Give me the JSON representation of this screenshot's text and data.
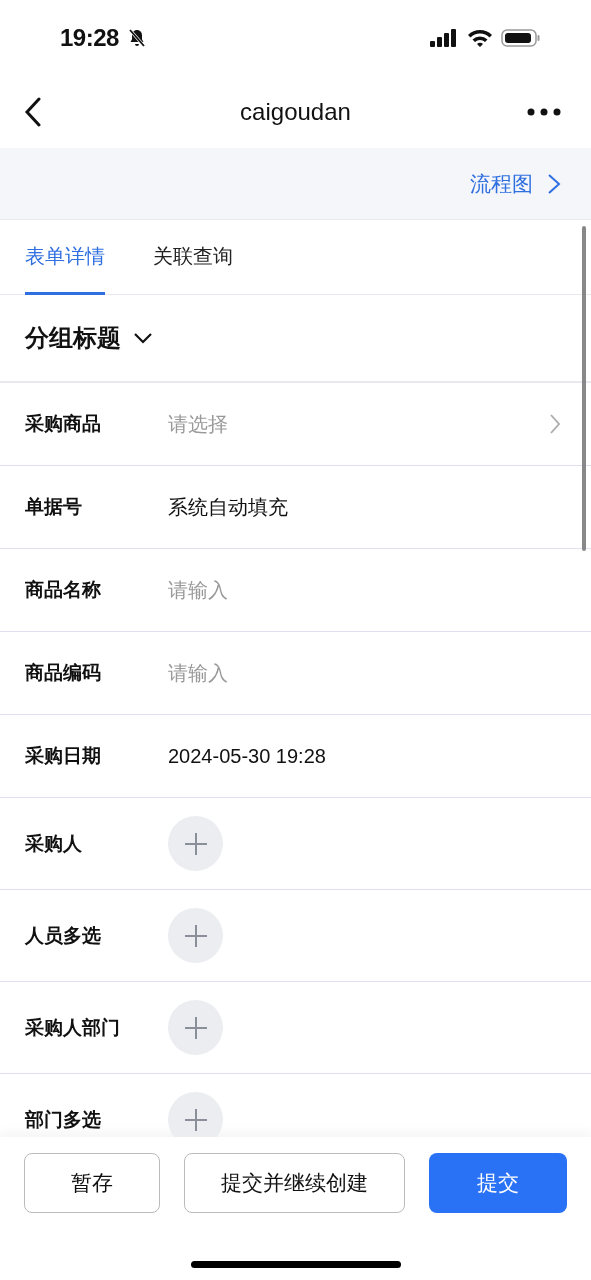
{
  "status_bar": {
    "time": "19:28"
  },
  "nav": {
    "title": "caigoudan"
  },
  "flow_link": {
    "label": "流程图"
  },
  "tabs": [
    {
      "label": "表单详情",
      "selected": true
    },
    {
      "label": "关联查询",
      "selected": false
    }
  ],
  "group": {
    "title": "分组标题",
    "expanded": true
  },
  "fields": [
    {
      "kind": "select",
      "label": "采购商品",
      "placeholder": "请选择"
    },
    {
      "kind": "text",
      "label": "单据号",
      "value": "系统自动填充"
    },
    {
      "kind": "input",
      "label": "商品名称",
      "placeholder": "请输入"
    },
    {
      "kind": "input",
      "label": "商品编码",
      "placeholder": "请输入"
    },
    {
      "kind": "text",
      "label": "采购日期",
      "value": "2024-05-30 19:28"
    },
    {
      "kind": "person",
      "label": "采购人"
    },
    {
      "kind": "person",
      "label": "人员多选"
    },
    {
      "kind": "person",
      "label": "采购人部门"
    },
    {
      "kind": "person",
      "label": "部门多选"
    }
  ],
  "buttons": [
    {
      "label": "暂存",
      "kind": "secondary"
    },
    {
      "label": "提交并继续创建",
      "kind": "secondary"
    },
    {
      "label": "提交",
      "kind": "primary"
    }
  ]
}
